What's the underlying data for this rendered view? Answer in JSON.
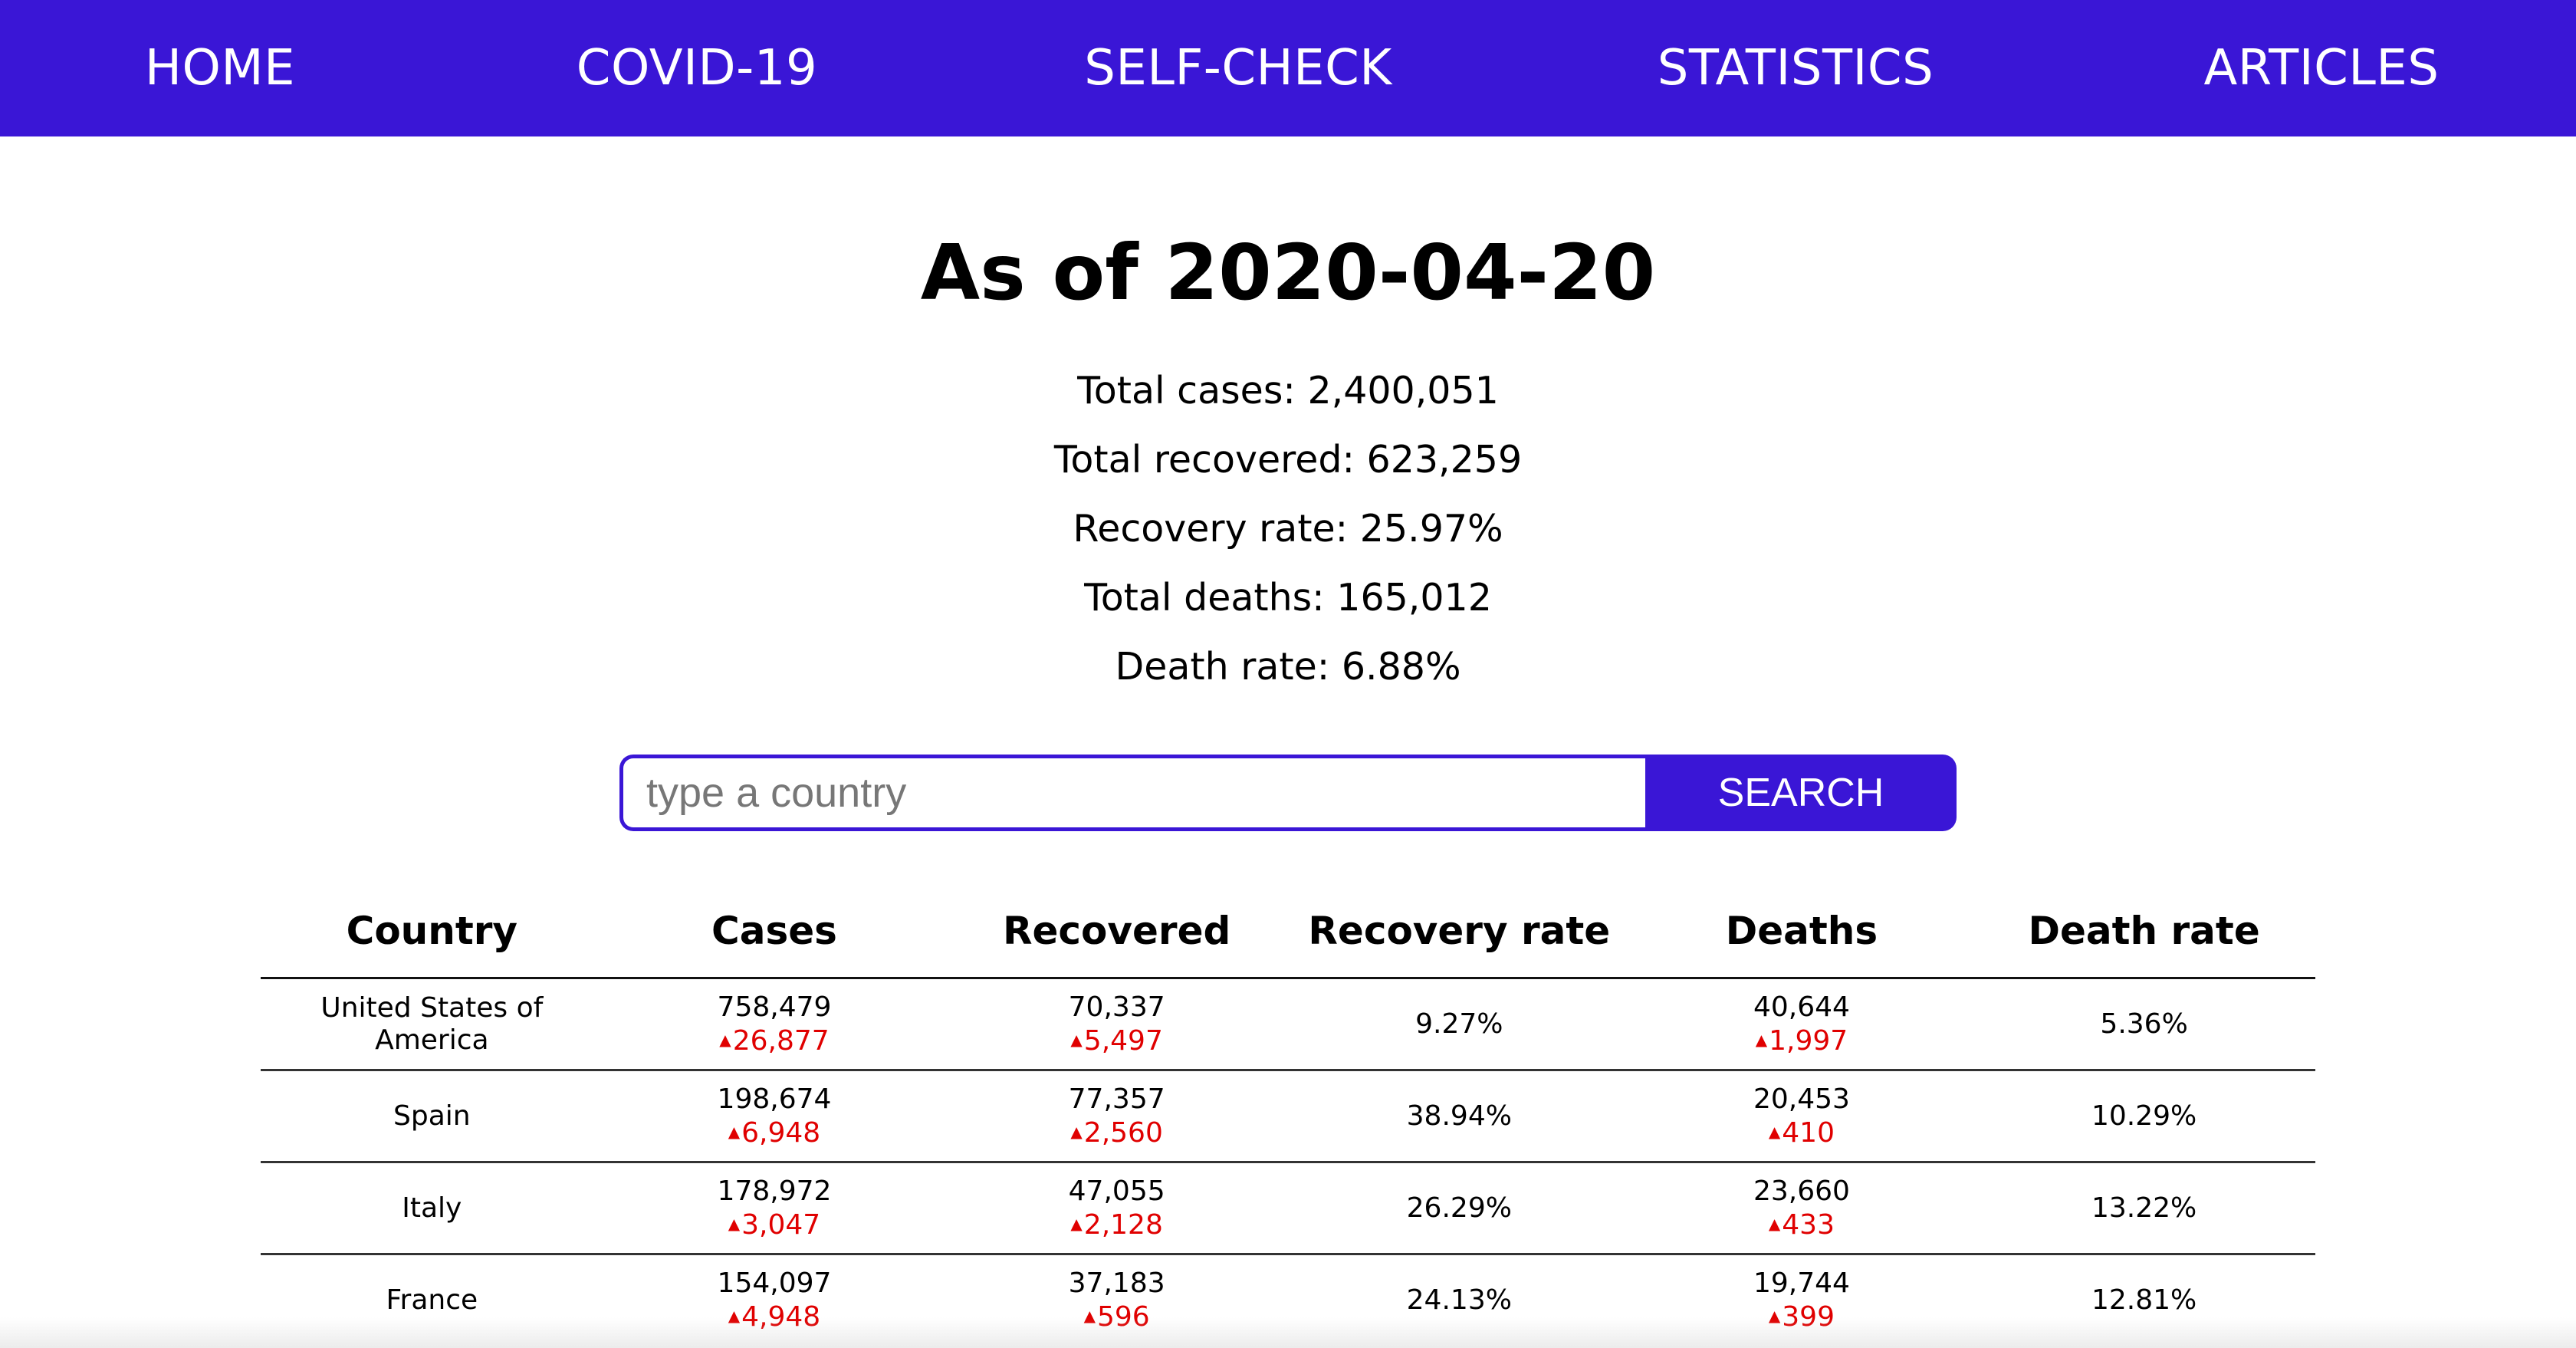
{
  "nav": {
    "items": [
      {
        "label": "HOME"
      },
      {
        "label": "COVID-19"
      },
      {
        "label": "SELF-CHECK"
      },
      {
        "label": "STATISTICS"
      },
      {
        "label": "ARTICLES"
      }
    ]
  },
  "header": {
    "title": "As of 2020-04-20"
  },
  "stats": {
    "total_cases": "Total cases: 2,400,051",
    "total_recovered": "Total recovered: 623,259",
    "recovery_rate": "Recovery rate: 25.97%",
    "total_deaths": "Total deaths: 165,012",
    "death_rate": "Death rate: 6.88%"
  },
  "search": {
    "placeholder": "type a country",
    "value": "",
    "button_label": "SEARCH"
  },
  "table": {
    "columns": [
      "Country",
      "Cases",
      "Recovered",
      "Recovery rate",
      "Deaths",
      "Death rate"
    ],
    "rows": [
      {
        "country": "United States of America",
        "cases": "758,479",
        "cases_delta": "26,877",
        "recovered": "70,337",
        "recovered_delta": "5,497",
        "recovery_rate": "9.27%",
        "deaths": "40,644",
        "deaths_delta": "1,997",
        "death_rate": "5.36%"
      },
      {
        "country": "Spain",
        "cases": "198,674",
        "cases_delta": "6,948",
        "recovered": "77,357",
        "recovered_delta": "2,560",
        "recovery_rate": "38.94%",
        "deaths": "20,453",
        "deaths_delta": "410",
        "death_rate": "10.29%"
      },
      {
        "country": "Italy",
        "cases": "178,972",
        "cases_delta": "3,047",
        "recovered": "47,055",
        "recovered_delta": "2,128",
        "recovery_rate": "26.29%",
        "deaths": "23,660",
        "deaths_delta": "433",
        "death_rate": "13.22%"
      },
      {
        "country": "France",
        "cases": "154,097",
        "cases_delta": "4,948",
        "recovered": "37,183",
        "recovered_delta": "596",
        "recovery_rate": "24.13%",
        "deaths": "19,744",
        "deaths_delta": "399",
        "death_rate": "12.81%"
      }
    ]
  },
  "colors": {
    "brand": "#3a16d6",
    "increase": "#e00000"
  },
  "icons": {
    "increase": "triangle-up-icon"
  }
}
